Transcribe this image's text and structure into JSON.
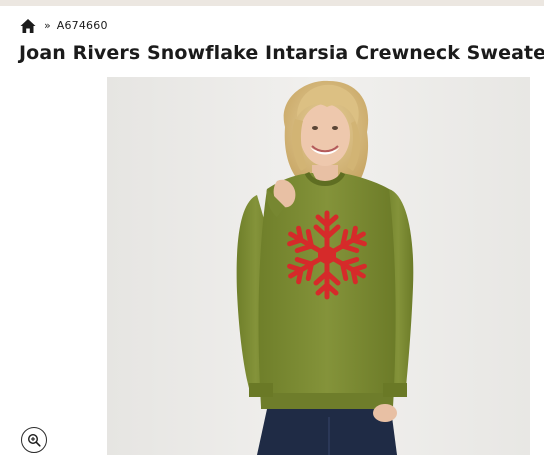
{
  "breadcrumb": {
    "separator": "»",
    "item_number": "A674660"
  },
  "product": {
    "title": "Joan Rivers Snowflake Intarsia Crewneck Sweater"
  },
  "colors": {
    "text": "#1b1b1b",
    "sweater_green": "#7f8e34",
    "snowflake_red": "#d62a2a",
    "photo_background": "#ecebe8"
  },
  "icons": {
    "home": "home-icon",
    "zoom": "zoom-in-icon"
  }
}
